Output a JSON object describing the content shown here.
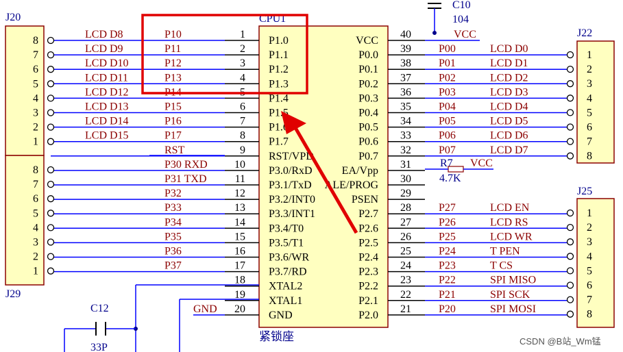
{
  "colors": {
    "wire": "#0000ff",
    "net": "#8b0000",
    "pin": "#000000",
    "label": "#00008b",
    "chip_fill": "#ffffc0",
    "chip_border": "#8b0000",
    "highlight": "#e00000"
  },
  "cpu": {
    "designator": "CPU1",
    "footnote": "紧锁座",
    "left_pins": [
      {
        "num": "1",
        "name": "P1.0",
        "net": "P10",
        "lcd": "LCD_D8"
      },
      {
        "num": "2",
        "name": "P1.1",
        "net": "P11",
        "lcd": "LCD_D9"
      },
      {
        "num": "3",
        "name": "P1.2",
        "net": "P12",
        "lcd": "LCD_D10"
      },
      {
        "num": "4",
        "name": "P1.3",
        "net": "P13",
        "lcd": "LCD_D11"
      },
      {
        "num": "5",
        "name": "P1.4",
        "net": "P14",
        "lcd": "LCD_D12"
      },
      {
        "num": "6",
        "name": "P1.5",
        "net": "P15",
        "lcd": "LCD_D13"
      },
      {
        "num": "7",
        "name": "P1.6",
        "net": "P16",
        "lcd": "LCD_D14"
      },
      {
        "num": "8",
        "name": "P1.7",
        "net": "P17",
        "lcd": "LCD_D15"
      },
      {
        "num": "9",
        "name": "RST/VPD",
        "net": "RST",
        "lcd": ""
      },
      {
        "num": "10",
        "name": "P3.0/RxD",
        "net": "P30_RXD",
        "lcd": ""
      },
      {
        "num": "11",
        "name": "P3.1/TxD",
        "net": "P31_TXD",
        "lcd": ""
      },
      {
        "num": "12",
        "name": "P3.2/INT0",
        "net": "P32",
        "lcd": ""
      },
      {
        "num": "13",
        "name": "P3.3/INT1",
        "net": "P33",
        "lcd": ""
      },
      {
        "num": "14",
        "name": "P3.4/T0",
        "net": "P34",
        "lcd": ""
      },
      {
        "num": "15",
        "name": "P3.5/T1",
        "net": "P35",
        "lcd": ""
      },
      {
        "num": "16",
        "name": "P3.6/WR",
        "net": "P36",
        "lcd": ""
      },
      {
        "num": "17",
        "name": "P3.7/RD",
        "net": "P37",
        "lcd": ""
      },
      {
        "num": "18",
        "name": "XTAL2",
        "net": "",
        "lcd": ""
      },
      {
        "num": "19",
        "name": "XTAL1",
        "net": "",
        "lcd": ""
      },
      {
        "num": "20",
        "name": "GND",
        "net": "GND",
        "lcd": ""
      }
    ],
    "right_pins": [
      {
        "num": "40",
        "name": "VCC",
        "net": "",
        "lcd": "VCC"
      },
      {
        "num": "39",
        "name": "P0.0",
        "net": "P00",
        "lcd": "LCD_D0"
      },
      {
        "num": "38",
        "name": "P0.1",
        "net": "P01",
        "lcd": "LCD_D1"
      },
      {
        "num": "37",
        "name": "P0.2",
        "net": "P02",
        "lcd": "LCD_D2"
      },
      {
        "num": "36",
        "name": "P0.3",
        "net": "P03",
        "lcd": "LCD_D3"
      },
      {
        "num": "35",
        "name": "P0.4",
        "net": "P04",
        "lcd": "LCD_D4"
      },
      {
        "num": "34",
        "name": "P0.5",
        "net": "P05",
        "lcd": "LCD_D5"
      },
      {
        "num": "33",
        "name": "P0.6",
        "net": "P06",
        "lcd": "LCD_D6"
      },
      {
        "num": "32",
        "name": "P0.7",
        "net": "P07",
        "lcd": "LCD_D7"
      },
      {
        "num": "31",
        "name": "EA/Vpp",
        "net": "",
        "lcd": ""
      },
      {
        "num": "30",
        "name": "ALE/PROG",
        "net": "",
        "lcd": ""
      },
      {
        "num": "29",
        "name": "PSEN",
        "net": "",
        "lcd": ""
      },
      {
        "num": "28",
        "name": "P2.7",
        "net": "P27",
        "lcd": "LCD_EN"
      },
      {
        "num": "27",
        "name": "P2.6",
        "net": "P26",
        "lcd": "LCD_RS"
      },
      {
        "num": "26",
        "name": "P2.5",
        "net": "P25",
        "lcd": "LCD_WR"
      },
      {
        "num": "25",
        "name": "P2.4",
        "net": "P24",
        "lcd": "T_PEN"
      },
      {
        "num": "24",
        "name": "P2.3",
        "net": "P23",
        "lcd": "T_CS"
      },
      {
        "num": "23",
        "name": "P2.2",
        "net": "P22",
        "lcd": "SPI_MISO"
      },
      {
        "num": "22",
        "name": "P2.1",
        "net": "P21",
        "lcd": "SPI_SCK"
      },
      {
        "num": "21",
        "name": "P2.0",
        "net": "P20",
        "lcd": "SPI_MOSI"
      }
    ]
  },
  "connectors": {
    "J20": {
      "label": "J20",
      "pins": [
        "8",
        "7",
        "6",
        "5",
        "4",
        "3",
        "2",
        "1"
      ]
    },
    "J29": {
      "label": "J29",
      "pins": [
        "8",
        "7",
        "6",
        "5",
        "4",
        "3",
        "2",
        "1"
      ]
    },
    "J22": {
      "label": "J22",
      "pins": [
        "1",
        "2",
        "3",
        "4",
        "5",
        "6",
        "7",
        "8"
      ]
    },
    "J25": {
      "label": "J25",
      "pins": [
        "1",
        "2",
        "3",
        "4",
        "5",
        "6",
        "7",
        "8"
      ]
    }
  },
  "components": {
    "C10": {
      "label": "C10",
      "value": "104"
    },
    "C12": {
      "label": "C12",
      "value": "33P"
    },
    "R7": {
      "label": "R7",
      "value": "4.7K",
      "net": "VCC"
    }
  },
  "watermark": "CSDN @B站_Wm锰"
}
